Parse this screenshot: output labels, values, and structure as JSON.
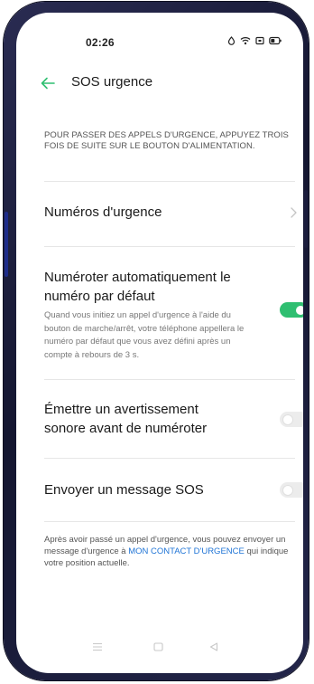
{
  "status_bar": {
    "time": "02:26",
    "icons": [
      "alarm-icon",
      "wifi-icon",
      "sim-icon",
      "battery-icon"
    ]
  },
  "header": {
    "back_icon": "arrow-left-icon",
    "title": "SOS urgence"
  },
  "intro": {
    "text": "POUR PASSER DES APPELS D'URGENCE, APPUYEZ TROIS FOIS DE SUITE SUR LE BOUTON D'ALIMENTATION."
  },
  "emergency_numbers": {
    "label": "Numéros d'urgence",
    "icon": "chevron-right-icon"
  },
  "auto_dial": {
    "title": "Numéroter automatiquement le numéro par défaut",
    "description": "Quand vous initiez un appel d'urgence à l'aide du bouton de marche/arrêt, votre téléphone appellera le numéro par défaut que vous avez défini après un compte à rebours de 3 s.",
    "enabled": true
  },
  "sound_warning": {
    "title": "Émettre un avertissement sonore avant de numéroter",
    "enabled": false
  },
  "sos_message": {
    "title": "Envoyer un message SOS",
    "enabled": false
  },
  "footer": {
    "text_before": "Après avoir passé un appel d'urgence, vous pouvez envoyer un message d'urgence à ",
    "link": "MON CONTACT D'URGENCE",
    "text_after": " qui indique votre position actuelle."
  },
  "nav_bar": {
    "icons": [
      "menu-icon",
      "home-icon",
      "back-icon"
    ]
  },
  "colors": {
    "accent": "#2fbf71",
    "link": "#1f74d6",
    "frame": "#1b1d3d"
  }
}
